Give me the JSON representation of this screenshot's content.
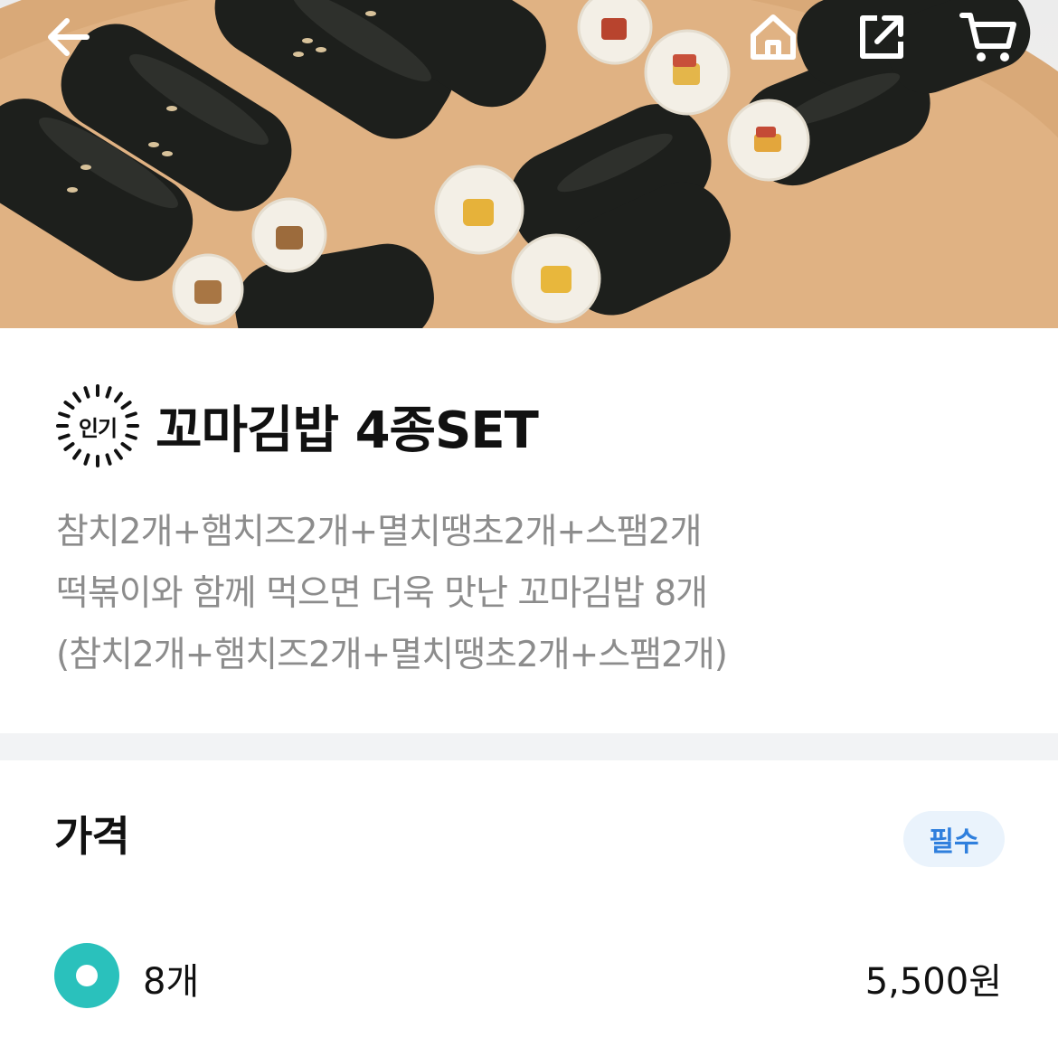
{
  "header": {
    "icons": [
      "arrow-left-icon",
      "home-icon",
      "share-icon",
      "cart-icon"
    ]
  },
  "hero": {
    "image_subject": "kimbap-rolls-photo"
  },
  "product": {
    "badge_label": "인기",
    "title": "꼬마김밥 4종SET",
    "description_lines": [
      "참치2개+햄치즈2개+멸치땡초2개+스팸2개",
      "떡볶이와 함께 먹으면 더욱 맛난 꼬마김밥 8개",
      "(참치2개+햄치즈2개+멸치땡초2개+스팸2개)"
    ]
  },
  "price_section": {
    "heading": "가격",
    "required_label": "필수",
    "options": [
      {
        "label": "8개",
        "price": "5,500원",
        "selected": true
      }
    ]
  },
  "colors": {
    "accent_mint": "#2ac1bc",
    "required_text": "#2f7fdd",
    "required_bg": "#eaf3fc",
    "description_text": "#8c8c8c",
    "divider": "#f2f3f5"
  }
}
